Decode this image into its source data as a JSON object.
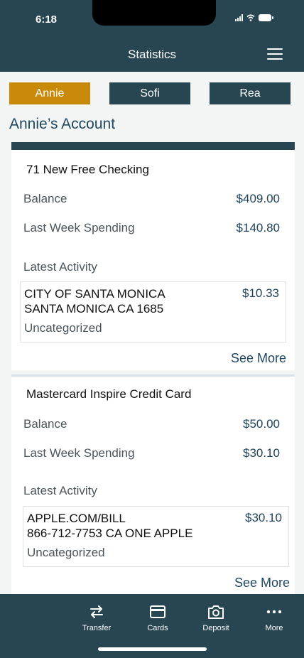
{
  "status": {
    "time": "6:18"
  },
  "header": {
    "title": "Statistics"
  },
  "person_tabs": [
    {
      "label": "Annie",
      "active": true
    },
    {
      "label": "Sofi",
      "active": false
    },
    {
      "label": "Rea",
      "active": false
    }
  ],
  "account_title": "Annie’s Account",
  "accounts": [
    {
      "name": "71 New Free Checking",
      "balance_label": "Balance",
      "balance": "$409.00",
      "spending_label": "Last Week Spending",
      "spending": "$140.80",
      "activity_label": "Latest Activity",
      "activity": {
        "line1": "CITY OF SANTA MONICA",
        "line2": "SANTA MONICA CA 1685",
        "amount": "$10.33",
        "category": "Uncategorized"
      },
      "see_more": "See More"
    },
    {
      "name": "Mastercard Inspire Credit Card",
      "balance_label": "Balance",
      "balance": "$50.00",
      "spending_label": "Last Week Spending",
      "spending": "$30.10",
      "activity_label": "Latest Activity",
      "activity": {
        "line1": "APPLE.COM/BILL",
        "line2": "866-712-7753 CA ONE APPLE",
        "amount": "$30.10",
        "category": "Uncategorized"
      },
      "see_more": "See More"
    }
  ],
  "bottom_nav": [
    {
      "label": "Transfer",
      "icon": "transfer-icon"
    },
    {
      "label": "Cards",
      "icon": "card-icon"
    },
    {
      "label": "Deposit",
      "icon": "camera-icon"
    },
    {
      "label": "More",
      "icon": "more-icon"
    }
  ],
  "colors": {
    "header": "#284552",
    "active_tab": "#c98a0c",
    "accent_text": "#20485f"
  }
}
